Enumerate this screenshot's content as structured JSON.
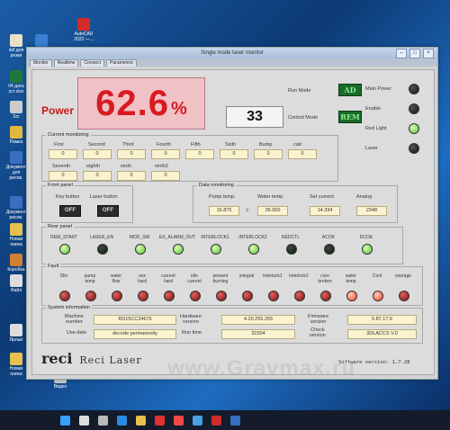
{
  "desktop_icons": [
    {
      "label": "dxf для\nрезки",
      "color": "#e9e1c4"
    },
    {
      "label": "CypCut-6.3...",
      "color": "#3a7fd0"
    },
    {
      "label": "AutoCAD\n2022 —...",
      "color": "#d32a2a"
    },
    {
      "label": "04 дата\nуст.xlsx",
      "color": "#1e7a3c"
    },
    {
      "label": "Scr",
      "color": "#cccccc"
    },
    {
      "label": "Рамка",
      "color": "#e0b840"
    },
    {
      "label": "Документ\nдля\nрисов.",
      "color": "#3a6fc0"
    },
    {
      "label": "Документ\nрисов.",
      "color": "#3a6fc0"
    },
    {
      "label": "Новая\nпапка",
      "color": "#e8c050"
    },
    {
      "label": "Коробка",
      "color": "#d08030"
    },
    {
      "label": "Файл",
      "color": "#dddddd"
    },
    {
      "label": "Ярлык",
      "color": "#dddddd"
    },
    {
      "label": "Новая\nпапка",
      "color": "#e8c050"
    },
    {
      "label": "Видео",
      "color": "#cccccc"
    }
  ],
  "window": {
    "title": "Single mode laser monitor",
    "tabs": [
      "Monitor",
      "Realtime",
      "Connect",
      "Parameters"
    ]
  },
  "power": {
    "label": "Power",
    "value": "62.6",
    "unit": "%"
  },
  "set_value": "33",
  "modes": {
    "run_mode_label": "Run Mode",
    "run_mode_value": "AD",
    "control_mode_label": "Control Mode",
    "control_mode_value": "REM"
  },
  "status_leds": [
    {
      "label": "Main Power",
      "state": "off"
    },
    {
      "label": "Enable",
      "state": "off"
    },
    {
      "label": "Red Light",
      "state": "green"
    },
    {
      "label": "Laser",
      "state": "off"
    }
  ],
  "current_monitoring": {
    "title": "Current monitoring",
    "row1": [
      {
        "label": "First",
        "value": "0"
      },
      {
        "label": "Second",
        "value": "0"
      },
      {
        "label": "Third",
        "value": "0"
      },
      {
        "label": "Fourth",
        "value": "0"
      },
      {
        "label": "Fifth",
        "value": "0"
      },
      {
        "label": "Sixth",
        "value": "0"
      },
      {
        "label": "Bump",
        "value": "0"
      },
      {
        "label": "calc",
        "value": "0"
      }
    ],
    "row2": [
      {
        "label": "Seventh",
        "value": "0"
      },
      {
        "label": "eighth",
        "value": "0"
      },
      {
        "label": "ninth",
        "value": "0"
      },
      {
        "label": "ninth2",
        "value": "0"
      }
    ]
  },
  "front_panel": {
    "title": "Front panel",
    "key_button_label": "Key button",
    "key_button_value": "OFF",
    "laser_button_label": "Laser button",
    "laser_button_value": "OFF"
  },
  "data_monitoring": {
    "title": "Data monitoring",
    "items": [
      {
        "label": "Pump temp.",
        "value": "15.875"
      },
      {
        "label": "Water temp.",
        "value": "35.000"
      },
      {
        "label": "Set current",
        "value": "14.334"
      },
      {
        "label": "Analog",
        "value": "2348"
      }
    ],
    "temp_sep": "?"
  },
  "rear_panel": {
    "title": "Rear panel",
    "items": [
      {
        "label": "REM_START",
        "state": "green"
      },
      {
        "label": "LASER_EN",
        "state": "dkgreen"
      },
      {
        "label": "MOD_SW",
        "state": "green"
      },
      {
        "label": "EX_ALARM_OUT",
        "state": "green"
      },
      {
        "label": "INTERLOCK1",
        "state": "green"
      },
      {
        "label": "INTERLOCK2",
        "state": "green"
      },
      {
        "label": "REDCTL",
        "state": "dkgreen"
      },
      {
        "label": "ACOK",
        "state": "dkgreen"
      },
      {
        "label": "DCOK",
        "state": "green"
      }
    ]
  },
  "fault": {
    "title": "Fault",
    "items": [
      {
        "label": "Dlin",
        "state": "red"
      },
      {
        "label": "pump\ntemp",
        "state": "red"
      },
      {
        "label": "water\nflow",
        "state": "red"
      },
      {
        "label": "sox\nhard",
        "state": "red"
      },
      {
        "label": "current\nhard",
        "state": "red"
      },
      {
        "label": "idle\ncurrent",
        "state": "red"
      },
      {
        "label": "present\nburning",
        "state": "red"
      },
      {
        "label": "integral",
        "state": "red"
      },
      {
        "label": "interlock1",
        "state": "red"
      },
      {
        "label": "interlock2",
        "state": "red"
      },
      {
        "label": "core\nbroken",
        "state": "red"
      },
      {
        "label": "water\ntemp",
        "state": "bright"
      },
      {
        "label": "Cool",
        "state": "bright"
      },
      {
        "label": "overage",
        "state": "red"
      }
    ]
  },
  "system_info": {
    "title": "System information",
    "machine_number_label": "Machine\nnumber",
    "machine_number_value": "RD15CC24676",
    "hardware_version_label": "Hardware\nversion",
    "hardware_version_value": "4.20.255.255",
    "firmware_version_label": "Firmware\nversion",
    "firmware_version_value": "5.87.17.6",
    "use_date_label": "Use date",
    "use_date_value": "decode permanently",
    "run_time_label": "Run time",
    "run_time_value": "31504",
    "check_version_label": "Check\nversion",
    "check_version_value": "3DLACCS V.0"
  },
  "brand": {
    "logo": "reci",
    "name": "Reci Laser"
  },
  "software_version": "Software version: 1.7.28",
  "watermark": "www.Gravmax.ru",
  "taskbar_icons": [
    "windows",
    "search",
    "task-view",
    "edge",
    "explorer",
    "yandex",
    "yandex-music",
    "app",
    "cypcut",
    "monitor"
  ]
}
